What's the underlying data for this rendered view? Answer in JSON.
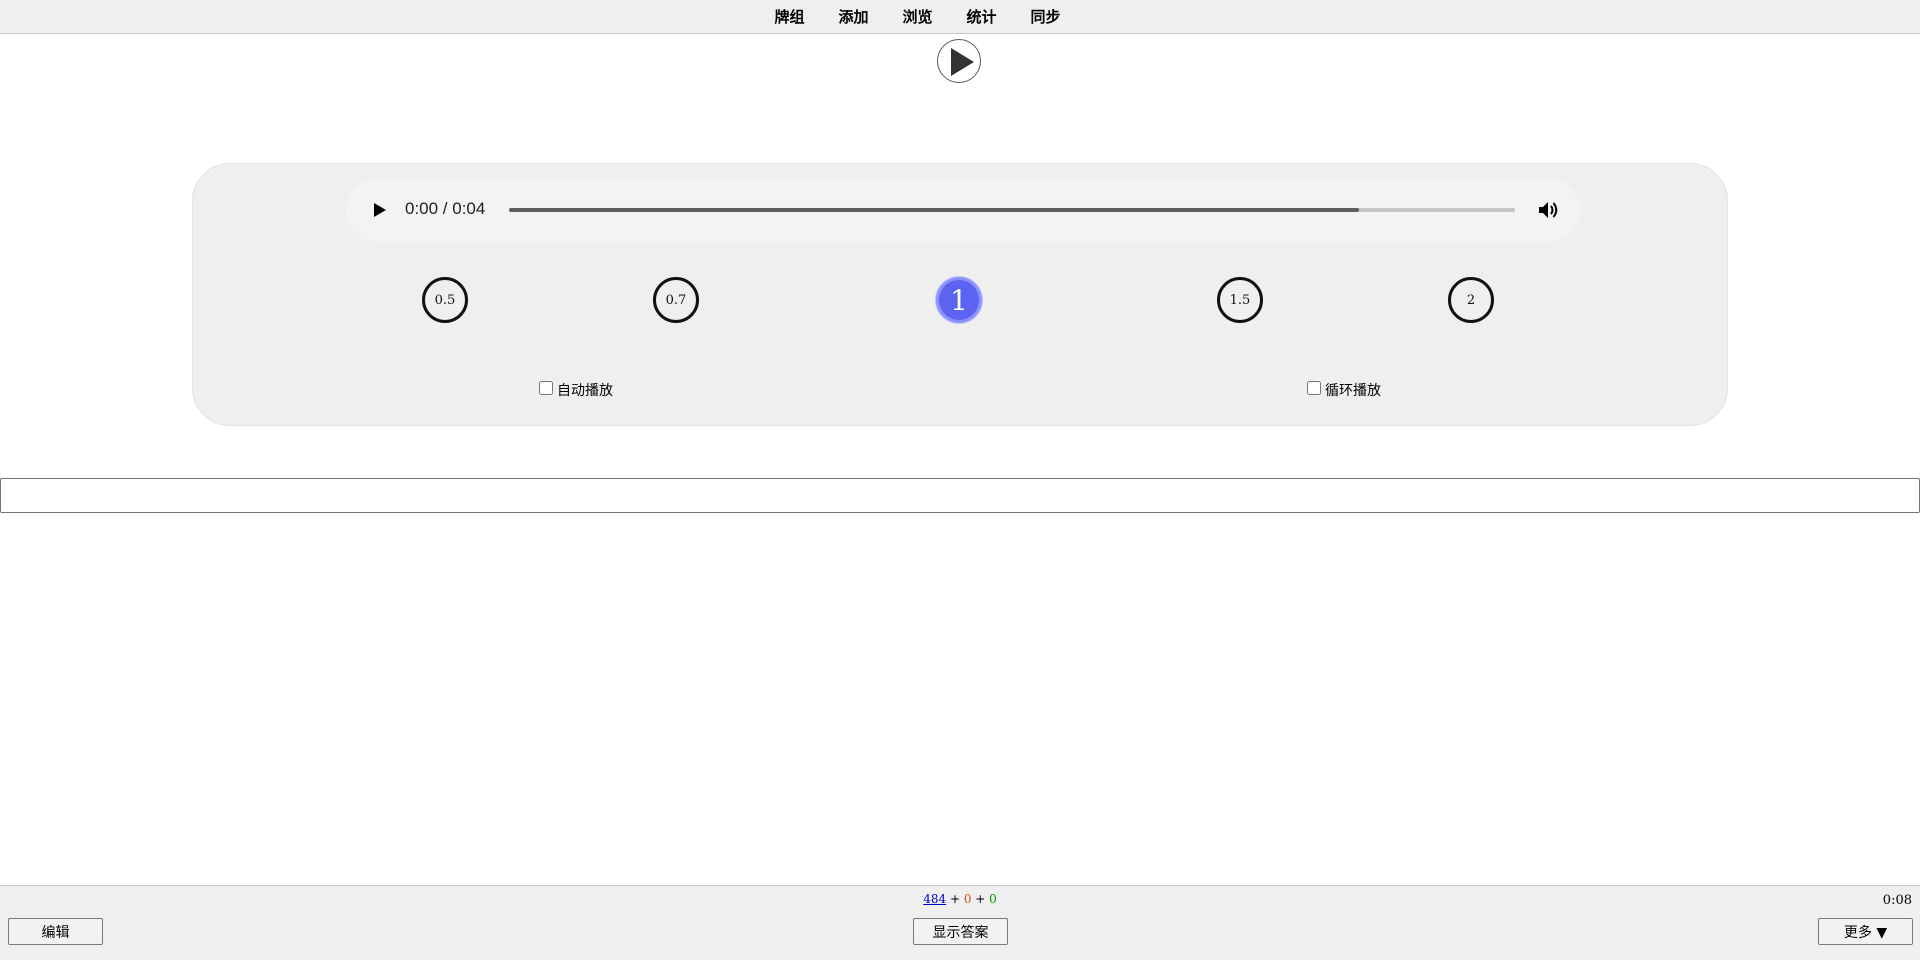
{
  "nav": {
    "decks": "牌组",
    "add": "添加",
    "browse": "浏览",
    "stats": "统计",
    "sync": "同步"
  },
  "audio": {
    "time": "0:00 / 0:04",
    "progress": 0.845
  },
  "speeds": [
    "0.5",
    "0.7",
    "1",
    "1.5",
    "2"
  ],
  "active_speed": "1",
  "options": {
    "autoplay": "自动播放",
    "loop": "循环播放"
  },
  "answer_input": {
    "value": ""
  },
  "bottom": {
    "new_count": "484",
    "sep1": " + ",
    "learn_count": "0",
    "sep2": " + ",
    "review_count": "0",
    "timer": "0:08",
    "edit_label": "编辑",
    "show_answer_label": "显示答案",
    "more_label": "更多 ▼"
  },
  "colors": {
    "active_speed_bg": "#5b63f0",
    "new_count": "#0000cc",
    "learn_count": "#c35617",
    "review_count": "#009900"
  }
}
